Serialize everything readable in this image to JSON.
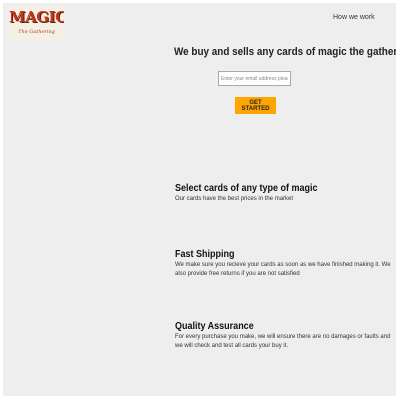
{
  "header": {
    "logo": {
      "title": "MAGIC",
      "subtitle": "The Gathering"
    },
    "nav": {
      "how_we_work": "How we work"
    }
  },
  "hero": {
    "headline": "We buy and sells any cards of magic the gathering",
    "email_placeholder": "Enter your email address please",
    "cta_label": "GET STARTED"
  },
  "features": [
    {
      "title": "Select cards of any type of magic",
      "description": "Our cards have the best prices in the market"
    },
    {
      "title": "Fast Shipping",
      "description": "We make sure you recieve your cards as soon as we have finished making it. We also provide free returns if you are not satisfied"
    },
    {
      "title": "Quality Assurance",
      "description": "For every purchase you make, we will ensure there are no damages or faults and we will check and test all cards your buy it."
    }
  ],
  "colors": {
    "page_background": "#eeeeee",
    "button": "#ffa500",
    "logo_red": "#c0361a"
  }
}
